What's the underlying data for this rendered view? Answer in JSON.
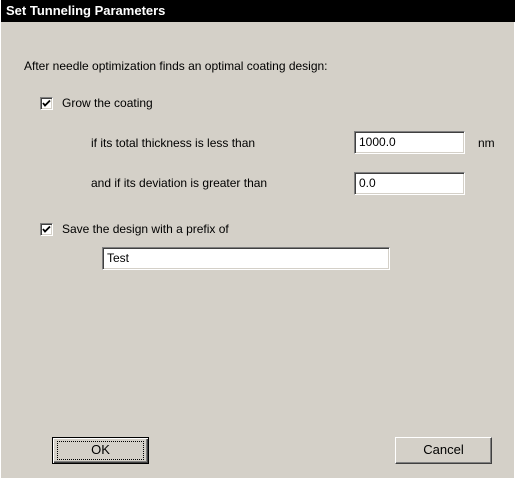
{
  "dialog": {
    "title": "Set Tunneling Parameters",
    "intro": "After needle optimization finds an optimal coating design:",
    "grow": {
      "checked": true,
      "label": "Grow the coating",
      "thickness_label": "if its total thickness is less than",
      "thickness_value": "1000.0",
      "thickness_unit": "nm",
      "deviation_label": "and if its deviation is greater than",
      "deviation_value": "0.0"
    },
    "save": {
      "checked": true,
      "label": "Save the design with a prefix of",
      "prefix_value": "Test"
    },
    "buttons": {
      "ok": "OK",
      "cancel": "Cancel"
    }
  }
}
